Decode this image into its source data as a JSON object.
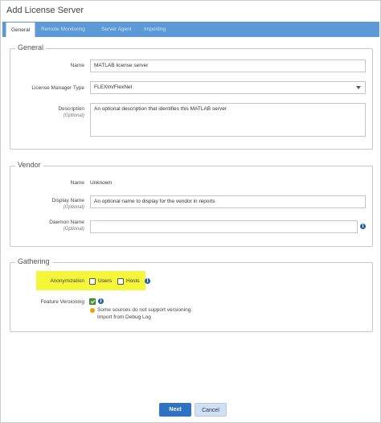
{
  "dialog": {
    "title": "Add License Server"
  },
  "tabs": [
    {
      "label": "General",
      "active": true
    },
    {
      "label": "Remote Monitoring",
      "active": false
    },
    {
      "label": "Server Agent",
      "active": false
    },
    {
      "label": "Importing",
      "active": false
    }
  ],
  "general": {
    "legend": "General",
    "name_label": "Name",
    "name_value": "MATLAB license server",
    "lm_type_label": "License Manager Type",
    "lm_type_value": "FLEXlm/FlexNet",
    "desc_label": "Description",
    "desc_optional": "(Optional)",
    "desc_value": "An optional description that identifies this MATLAB server"
  },
  "vendor": {
    "legend": "Vendor",
    "name_label": "Name",
    "name_value": "Unknown",
    "display_label": "Display Name",
    "display_optional": "(Optional)",
    "display_placeholder": "An optional name to display for the vendor in reports",
    "daemon_label": "Daemon Name",
    "daemon_optional": "(Optional)",
    "daemon_value": ""
  },
  "gathering": {
    "legend": "Gathering",
    "anon_label": "Anonymization",
    "users_label": "Users",
    "users_checked": false,
    "hosts_label": "Hosts",
    "hosts_checked": false,
    "highlight_color": "#f5f53a",
    "fv_label": "Feature Versioning",
    "fv_checked": true,
    "note_line1": "Some sources do not support versioning:",
    "note_line2": "Import from Debug Log"
  },
  "footer": {
    "next_label": "Next",
    "cancel_label": "Cancel"
  },
  "colors": {
    "tab_strip": "#5b9ad6",
    "primary_button": "#2e72c4",
    "info_icon": "#1e5fa6",
    "warn_icon": "#f0a000",
    "check_green": "#4a9a3a"
  }
}
